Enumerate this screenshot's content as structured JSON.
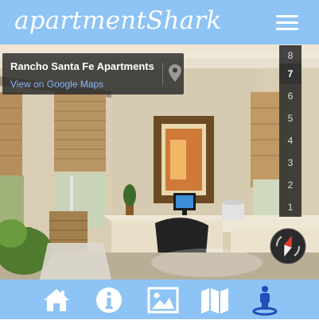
{
  "header": {
    "brand": "apartmentShark"
  },
  "location": {
    "name": "Rancho Santa Fe Apartments",
    "map_link": "View on Google Maps"
  },
  "floor_selector": {
    "floors": [
      "8",
      "7",
      "6",
      "5",
      "4",
      "3",
      "2",
      "1"
    ],
    "active": "7"
  },
  "footer_nav": {
    "items": [
      "home-icon",
      "info-icon",
      "image-icon",
      "map-icon",
      "street-view-icon"
    ],
    "active": "street-view-icon"
  },
  "colors": {
    "brand": "#8ec3f5",
    "nav_active": "#1f4fb8",
    "nav_icon": "#ffffff"
  }
}
